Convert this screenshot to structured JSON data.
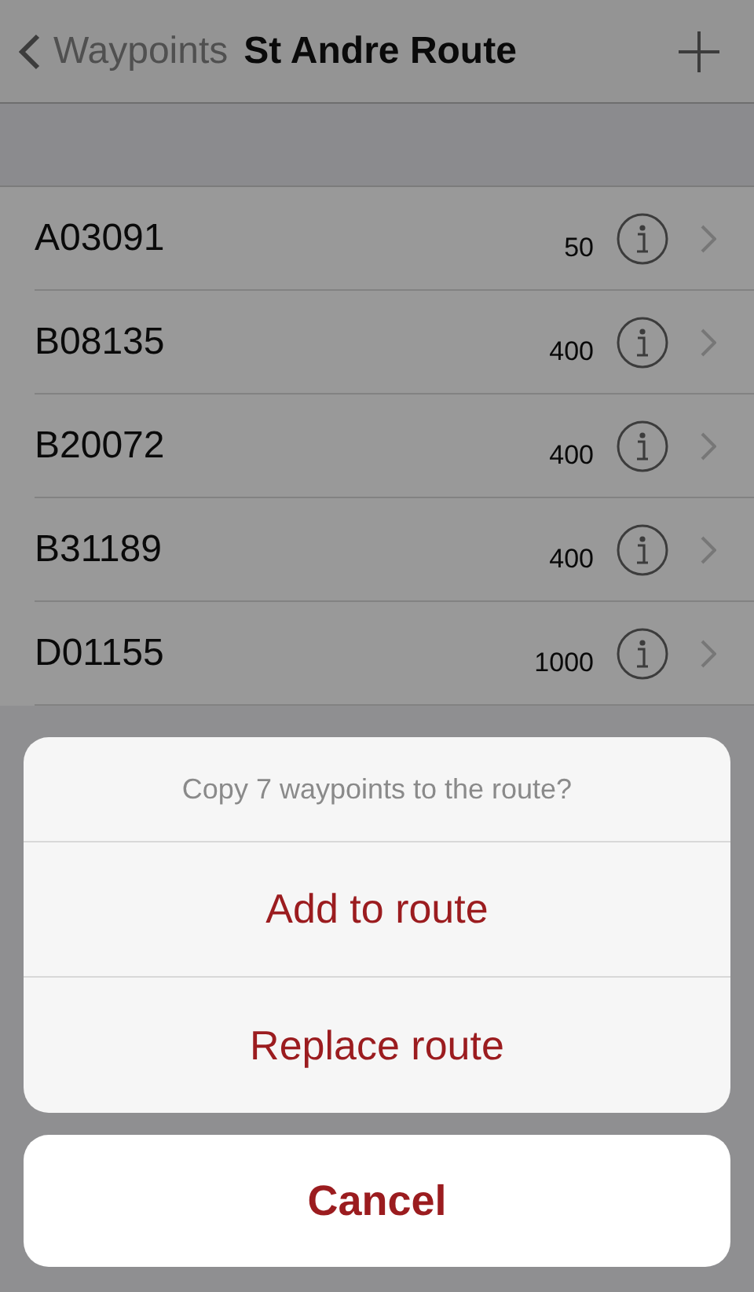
{
  "nav": {
    "back_label": "Waypoints",
    "title": "St Andre Route"
  },
  "waypoints": [
    {
      "name": "A03091",
      "value": "50"
    },
    {
      "name": "B08135",
      "value": "400"
    },
    {
      "name": "B20072",
      "value": "400"
    },
    {
      "name": "B31189",
      "value": "400"
    },
    {
      "name": "D01155",
      "value": "1000"
    }
  ],
  "action_sheet": {
    "message": "Copy 7 waypoints to the route?",
    "actions": [
      "Add to route",
      "Replace route"
    ],
    "cancel": "Cancel"
  }
}
